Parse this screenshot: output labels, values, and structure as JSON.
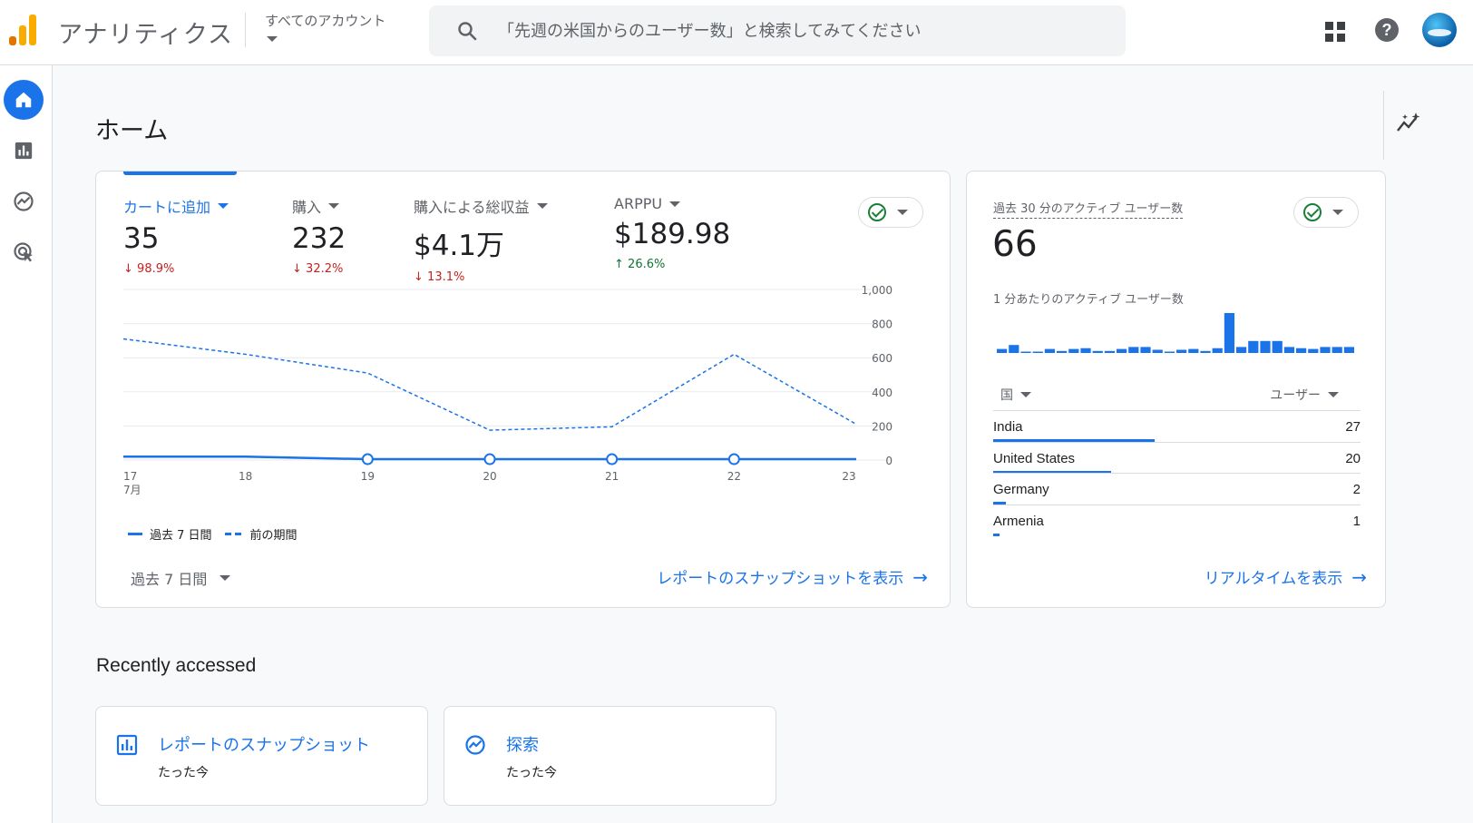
{
  "app": {
    "title": "アナリティクス",
    "account_label": "すべてのアカウント"
  },
  "search": {
    "placeholder": "「先週の米国からのユーザー数」と検索してみてください"
  },
  "nav": {
    "items": [
      "home-icon",
      "reports-icon",
      "explore-icon",
      "advertising-icon"
    ]
  },
  "page": {
    "title": "ホーム"
  },
  "main_card": {
    "metrics": [
      {
        "label": "カートに追加",
        "value": "35",
        "delta": "98.9%",
        "direction": "down"
      },
      {
        "label": "購入",
        "value": "232",
        "delta": "32.2%",
        "direction": "down"
      },
      {
        "label": "購入による総収益",
        "value": "$4.1万",
        "delta": "13.1%",
        "direction": "down"
      },
      {
        "label": "ARPPU",
        "value": "$189.98",
        "delta": "26.6%",
        "direction": "up"
      }
    ],
    "legend_current": "過去 7 日間",
    "legend_previous": "前の期間",
    "period_select": "過去 7 日間",
    "link": "レポートのスナップショットを表示",
    "x_month_label": "7月"
  },
  "chart_data": {
    "type": "line",
    "categories": [
      "17",
      "18",
      "19",
      "20",
      "21",
      "22",
      "23"
    ],
    "y_ticks": [
      "1,000",
      "800",
      "600",
      "400",
      "200",
      "0"
    ],
    "ylim": [
      0,
      1000
    ],
    "series": [
      {
        "name": "過去 7 日間",
        "values": [
          20,
          20,
          5,
          5,
          5,
          5,
          5
        ],
        "style": "solid"
      },
      {
        "name": "前の期間",
        "values": [
          710,
          620,
          510,
          175,
          195,
          620,
          210
        ],
        "style": "dashed"
      }
    ],
    "color": "#1a73e8"
  },
  "realtime": {
    "label": "過去 30 分のアクティブ ユーザー数",
    "value": "66",
    "sub_label": "1 分あたりのアクティブ ユーザー数",
    "bars": [
      1,
      2,
      0.3,
      0.3,
      1,
      0.5,
      1,
      1.2,
      0.5,
      0.5,
      1,
      1.5,
      1.5,
      0.8,
      0.3,
      0.8,
      1,
      0.5,
      1.2,
      10,
      1.5,
      3,
      3,
      3,
      1.5,
      1.2,
      1,
      1.5,
      1.5,
      1.5
    ],
    "col_country": "国",
    "col_users": "ユーザー",
    "rows": [
      {
        "country": "India",
        "users": "27",
        "share": 0.44
      },
      {
        "country": "United States",
        "users": "20",
        "share": 0.32
      },
      {
        "country": "Germany",
        "users": "2",
        "share": 0.035
      },
      {
        "country": "Armenia",
        "users": "1",
        "share": 0.018
      }
    ],
    "link": "リアルタイムを表示"
  },
  "recent": {
    "title": "Recently accessed",
    "items": [
      {
        "title": "レポートのスナップショット",
        "sub": "たった今",
        "icon": "report-snapshot-icon"
      },
      {
        "title": "探索",
        "sub": "たった今",
        "icon": "explore-icon"
      }
    ]
  },
  "colors": {
    "accent": "#1a73e8",
    "down": "#c5221f",
    "up": "#137333",
    "logo": "#f9ab00"
  }
}
